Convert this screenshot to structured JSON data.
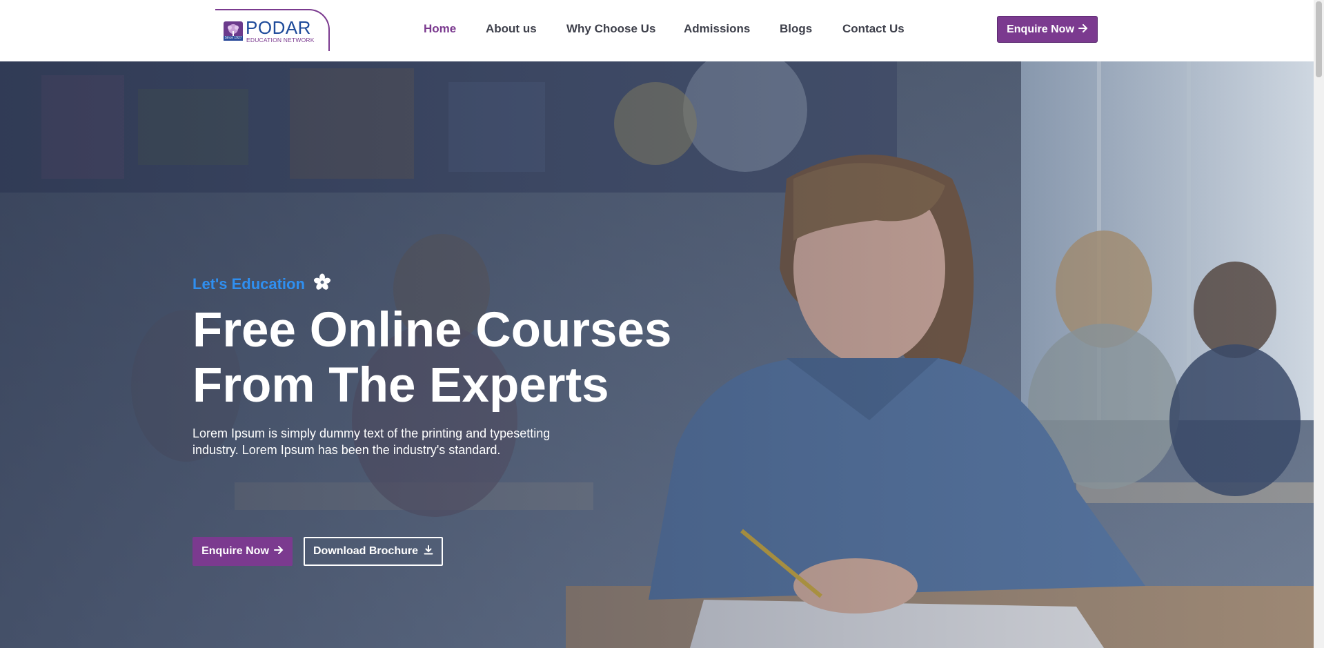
{
  "brand": {
    "name": "PODAR",
    "subtitle": "EDUCATION NETWORK",
    "since": "Since 1927",
    "colors": {
      "purple": "#7b3a8f",
      "blue": "#1d4a9a",
      "accent_blue": "#2f8ff0"
    }
  },
  "nav": {
    "items": [
      {
        "label": "Home",
        "active": true
      },
      {
        "label": "About us",
        "active": false
      },
      {
        "label": "Why Choose Us",
        "active": false
      },
      {
        "label": "Admissions",
        "active": false
      },
      {
        "label": "Blogs",
        "active": false
      },
      {
        "label": "Contact Us",
        "active": false
      }
    ],
    "cta_label": "Enquire Now",
    "cta_icon": "arrow-right-icon"
  },
  "hero": {
    "tagline": "Let's Education",
    "tagline_icon": "flower-icon",
    "headline_line1": "Free Online Courses",
    "headline_line2": "From The Experts",
    "description": "Lorem Ipsum is simply dummy text of the printing and typesetting industry. Lorem Ipsum has been the industry's standard.",
    "primary_button": "Enquire Now",
    "primary_icon": "arrow-right-icon",
    "secondary_button": "Download Brochure",
    "secondary_icon": "download-icon",
    "background": "classroom-photo-girl-writing"
  }
}
